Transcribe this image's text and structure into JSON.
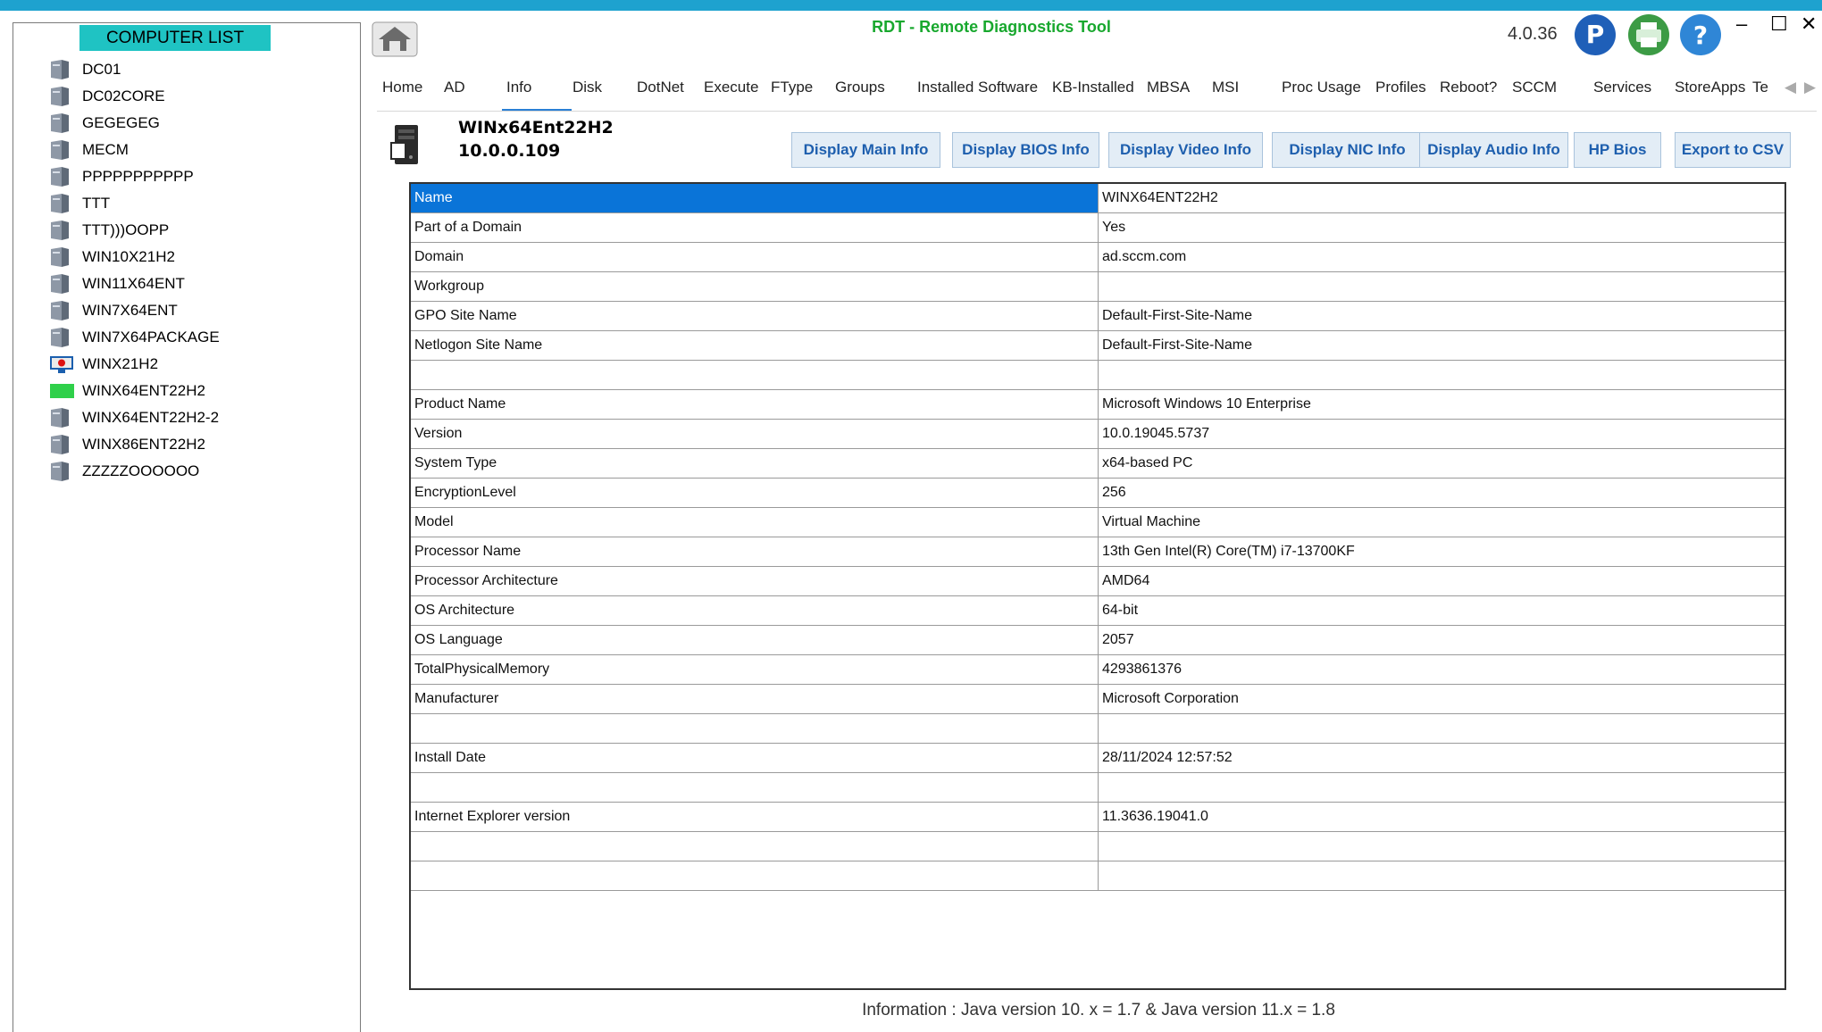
{
  "app": {
    "title": "RDT - Remote Diagnostics Tool",
    "version": "4.0.36",
    "accent_color": "#1ea2cf",
    "title_color": "#18a82e"
  },
  "window_controls": {
    "minimize": "–",
    "maximize": "☐",
    "close": "✕"
  },
  "computer_list": {
    "header": "COMPUTER LIST",
    "items": [
      {
        "label": "DC01",
        "icon": "computer-icon"
      },
      {
        "label": "DC02CORE",
        "icon": "computer-icon"
      },
      {
        "label": "GEGEGEG",
        "icon": "computer-icon"
      },
      {
        "label": "MECM",
        "icon": "computer-icon"
      },
      {
        "label": "PPPPPPPPPPP",
        "icon": "computer-icon"
      },
      {
        "label": "TTT",
        "icon": "computer-icon"
      },
      {
        "label": "TTT)))OOPP",
        "icon": "computer-icon"
      },
      {
        "label": "WIN10X21H2",
        "icon": "computer-icon"
      },
      {
        "label": "WIN11X64ENT",
        "icon": "computer-icon"
      },
      {
        "label": "WIN7X64ENT",
        "icon": "computer-icon"
      },
      {
        "label": "WIN7X64PACKAGE",
        "icon": "computer-icon"
      },
      {
        "label": "WINX21H2",
        "icon": "monitor-status-icon"
      },
      {
        "label": "WINX64ENT22H2",
        "icon": "online-status-icon"
      },
      {
        "label": "WINX64ENT22H2-2",
        "icon": "computer-icon"
      },
      {
        "label": "WINX86ENT22H2",
        "icon": "computer-icon"
      },
      {
        "label": "ZZZZZOOOOOO",
        "icon": "computer-icon"
      }
    ]
  },
  "tabs": {
    "active": "Info",
    "items": [
      "Home",
      "AD",
      "Info",
      "Disk",
      "DotNet",
      "Execute",
      "FType",
      "Groups",
      "Installed Software",
      "KB-Installed",
      "MBSA",
      "MSI",
      "Proc Usage",
      "Profiles",
      "Reboot?",
      "SCCM",
      "Services",
      "StoreApps",
      "Te"
    ],
    "scroll_left": "◀",
    "scroll_right": "▶"
  },
  "host": {
    "name": "WINx64Ent22H2",
    "ip": "10.0.0.109"
  },
  "actions": {
    "main_info": "Display Main Info",
    "bios_info": "Display BIOS Info",
    "video_info": "Display Video Info",
    "nic_info": "Display NIC Info",
    "audio_info": "Display Audio Info",
    "hp_bios": "HP Bios",
    "export_csv": "Export to CSV"
  },
  "info_table": {
    "selected_row": 0,
    "rows": [
      {
        "key": "Name",
        "value": "WINX64ENT22H2"
      },
      {
        "key": "Part of a Domain",
        "value": "Yes"
      },
      {
        "key": "Domain",
        "value": "ad.sccm.com"
      },
      {
        "key": "Workgroup",
        "value": ""
      },
      {
        "key": "GPO Site Name",
        "value": "Default-First-Site-Name"
      },
      {
        "key": "Netlogon Site Name",
        "value": "Default-First-Site-Name"
      },
      {
        "key": "",
        "value": ""
      },
      {
        "key": "Product Name",
        "value": "Microsoft Windows 10 Enterprise"
      },
      {
        "key": "Version",
        "value": "10.0.19045.5737"
      },
      {
        "key": "System Type",
        "value": "x64-based PC"
      },
      {
        "key": "EncryptionLevel",
        "value": "256"
      },
      {
        "key": "Model",
        "value": "Virtual Machine"
      },
      {
        "key": "Processor Name",
        "value": "13th Gen Intel(R) Core(TM) i7-13700KF"
      },
      {
        "key": "Processor Architecture",
        "value": "AMD64"
      },
      {
        "key": "OS Architecture",
        "value": "64-bit"
      },
      {
        "key": "OS Language",
        "value": "2057"
      },
      {
        "key": "TotalPhysicalMemory",
        "value": "4293861376"
      },
      {
        "key": "Manufacturer",
        "value": "Microsoft Corporation"
      },
      {
        "key": "",
        "value": ""
      },
      {
        "key": "Install Date",
        "value": "28/11/2024 12:57:52"
      },
      {
        "key": "",
        "value": ""
      },
      {
        "key": "Internet Explorer version",
        "value": "11.3636.19041.0"
      },
      {
        "key": "",
        "value": ""
      },
      {
        "key": "",
        "value": ""
      }
    ]
  },
  "footer": {
    "info": "Information : Java version 10. x = 1.7  &  Java version 11.x = 1.8"
  }
}
